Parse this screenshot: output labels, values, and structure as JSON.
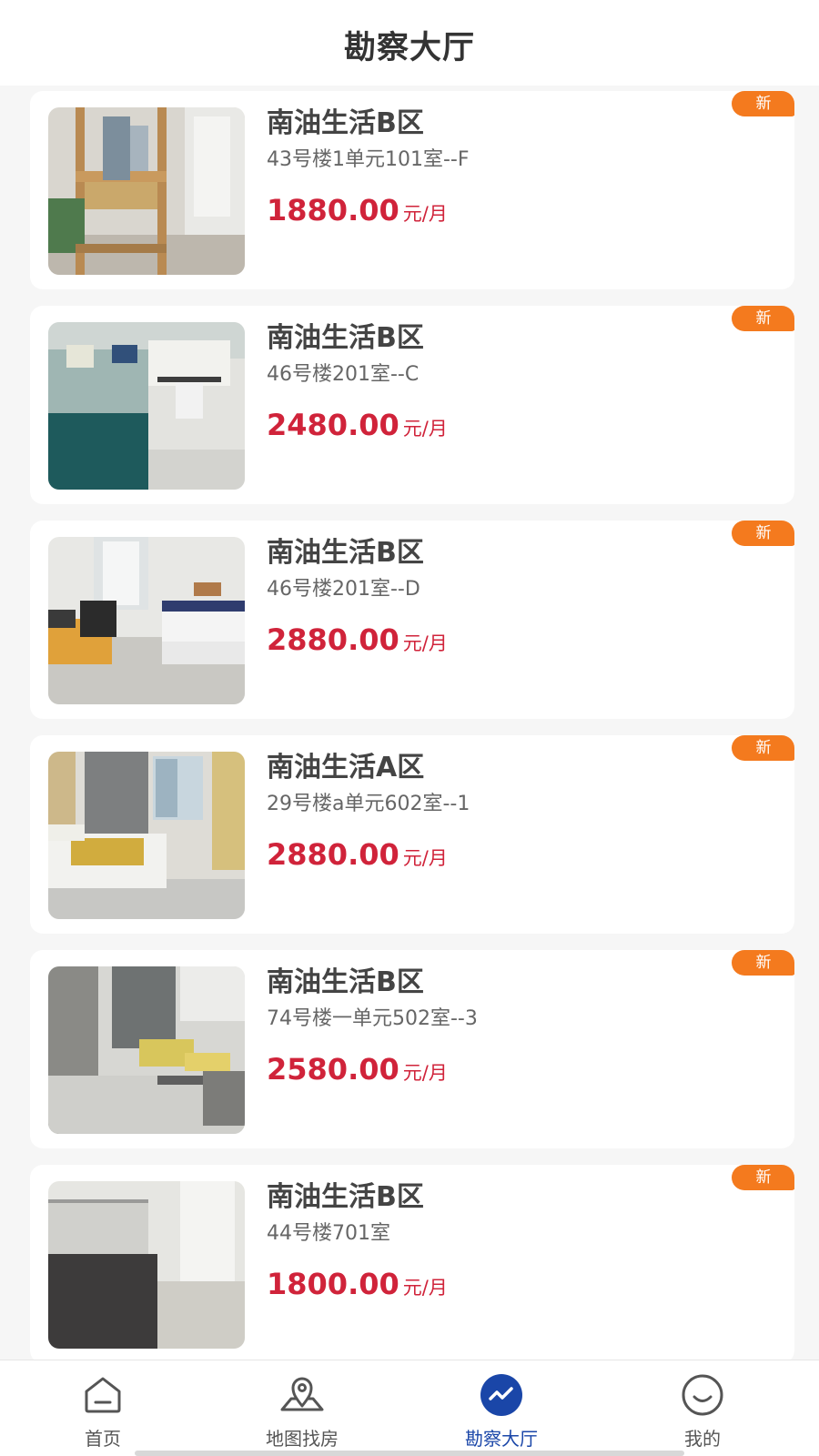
{
  "header": {
    "title": "勘察大厅"
  },
  "listings": [
    {
      "name": "南油生活B区",
      "address": "43号楼1单元101室--F",
      "price": "1880.00",
      "unit": "元/月",
      "badge": "新",
      "photo": "room-photo-bunkbed"
    },
    {
      "name": "南油生活B区",
      "address": "46号楼201室--C",
      "price": "2480.00",
      "unit": "元/月",
      "badge": "新",
      "photo": "room-photo-bed-teal"
    },
    {
      "name": "南油生活B区",
      "address": "46号楼201室--D",
      "price": "2880.00",
      "unit": "元/月",
      "badge": "新",
      "photo": "room-photo-desk-bed"
    },
    {
      "name": "南油生活A区",
      "address": "29号楼a单元602室--1",
      "price": "2880.00",
      "unit": "元/月",
      "badge": "新",
      "photo": "room-photo-bed-window"
    },
    {
      "name": "南油生活B区",
      "address": "74号楼一单元502室--3",
      "price": "2580.00",
      "unit": "元/月",
      "badge": "新",
      "photo": "room-photo-grey-room"
    },
    {
      "name": "南油生活B区",
      "address": "44号楼701室",
      "price": "1800.00",
      "unit": "元/月",
      "badge": "新",
      "photo": "room-photo-dark-bed"
    }
  ],
  "tabbar": {
    "items": [
      {
        "label": "首页",
        "icon": "home-icon"
      },
      {
        "label": "地图找房",
        "icon": "map-pin-icon"
      },
      {
        "label": "勘察大厅",
        "icon": "survey-hall-icon",
        "active": true
      },
      {
        "label": "我的",
        "icon": "profile-smile-icon"
      }
    ]
  },
  "colors": {
    "price": "#d0233a",
    "badge": "#f47a1e",
    "active_tab": "#1a46a8"
  }
}
